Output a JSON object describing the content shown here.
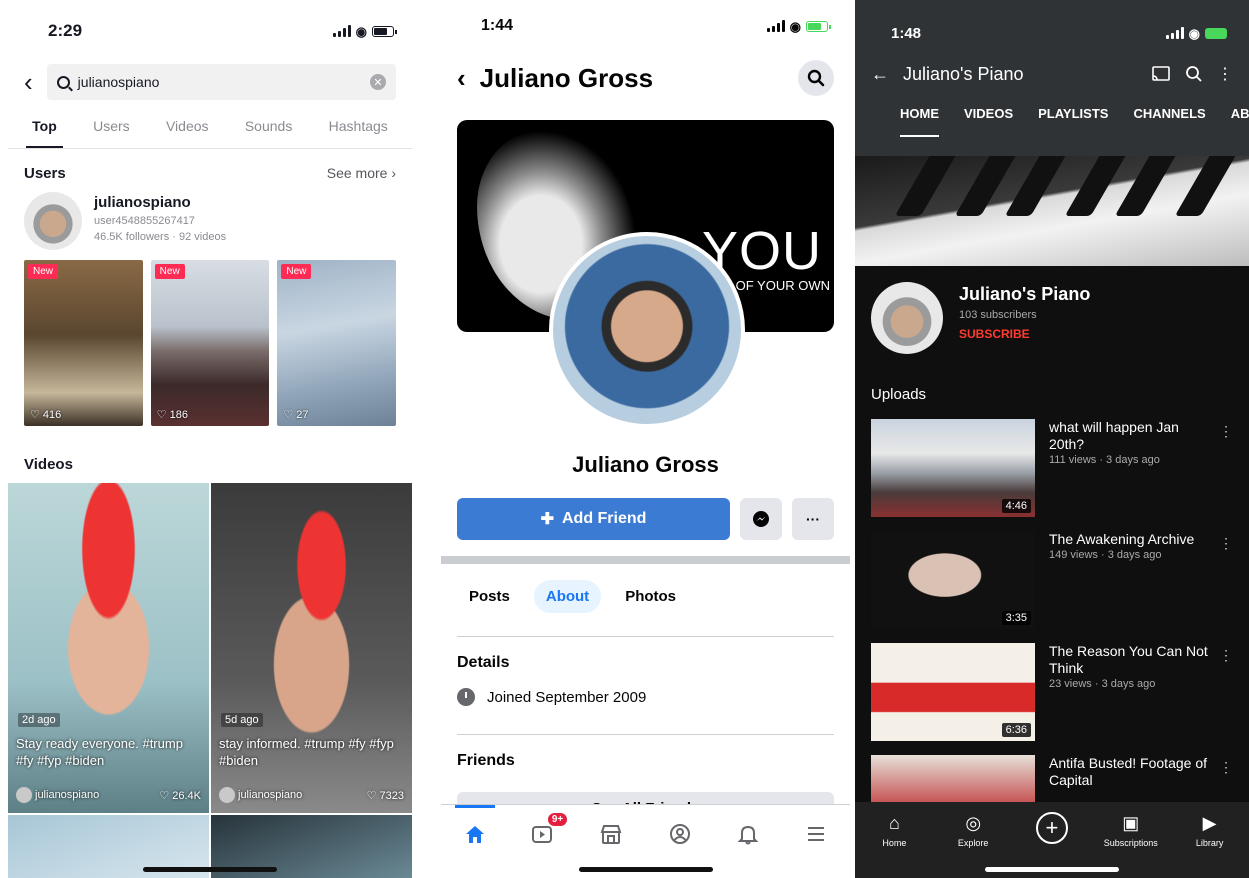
{
  "tiktok": {
    "status_time": "2:29",
    "search_query": "julianospiano",
    "tabs": [
      "Top",
      "Users",
      "Videos",
      "Sounds",
      "Hashtags"
    ],
    "users_heading": "Users",
    "see_more": "See more",
    "user": {
      "name": "julianospiano",
      "id": "user4548855267417",
      "stats": "46.5K followers · 92 videos"
    },
    "thumbs": [
      {
        "tag": "New",
        "likes": "416"
      },
      {
        "tag": "New",
        "likes": "186"
      },
      {
        "tag": "New",
        "likes": "27"
      }
    ],
    "videos_heading": "Videos",
    "videos": [
      {
        "ago": "2d ago",
        "caption": "Stay ready everyone. #trump #fy #fyp #biden",
        "author": "julianospiano",
        "likes": "26.4K"
      },
      {
        "ago": "5d ago",
        "caption": "stay informed. #trump #fy #fyp #biden",
        "author": "julianospiano",
        "likes": "7323"
      }
    ]
  },
  "facebook": {
    "status_time": "1:44",
    "title": "Juliano Gross",
    "cover_text_big": "YOU",
    "cover_text_small": "OF YOUR OWN",
    "name": "Juliano Gross",
    "add_friend": "Add Friend",
    "more_label": "···",
    "tabs": [
      "Posts",
      "About",
      "Photos"
    ],
    "details_heading": "Details",
    "joined": "Joined September 2009",
    "friends_heading": "Friends",
    "see_all_friends": "See All Friends",
    "video_badge": "9+"
  },
  "youtube": {
    "status_time": "1:48",
    "title": "Juliano's Piano",
    "tabs": [
      "HOME",
      "VIDEOS",
      "PLAYLISTS",
      "CHANNELS",
      "AB"
    ],
    "channel_name": "Juliano's Piano",
    "subscribers": "103 subscribers",
    "subscribe": "SUBSCRIBE",
    "uploads_heading": "Uploads",
    "videos": [
      {
        "title": "what will happen Jan 20th?",
        "meta": "111 views · 3 days ago",
        "duration": "4:46"
      },
      {
        "title": "The Awakening Archive",
        "meta": "149 views · 3 days ago",
        "duration": "3:35"
      },
      {
        "title": "The Reason You Can Not Think",
        "meta": "23 views · 3 days ago",
        "duration": "6:36"
      },
      {
        "title": "Antifa Busted! Footage of Capital",
        "meta": "",
        "duration": ""
      }
    ],
    "nav": [
      "Home",
      "Explore",
      "",
      "Subscriptions",
      "Library"
    ]
  }
}
